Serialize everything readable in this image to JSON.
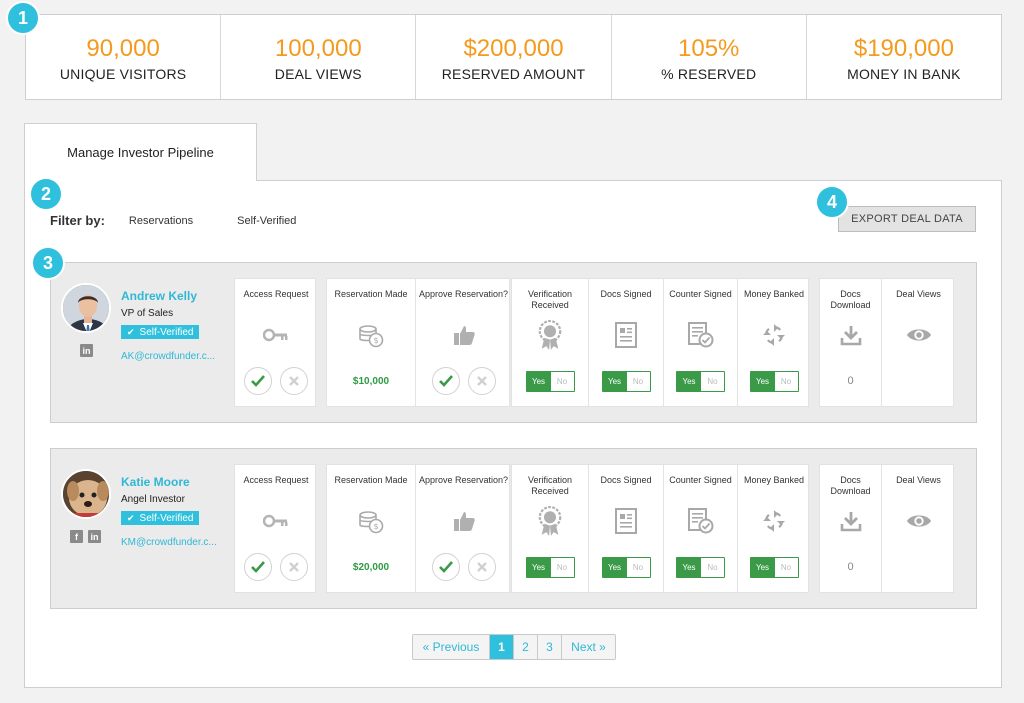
{
  "stats": [
    {
      "value": "90,000",
      "label": "UNIQUE VISITORS"
    },
    {
      "value": "100,000",
      "label": "DEAL VIEWS"
    },
    {
      "value": "$200,000",
      "label": "RESERVED AMOUNT"
    },
    {
      "value": "105%",
      "label": "% RESERVED"
    },
    {
      "value": "$190,000",
      "label": "MONEY IN BANK"
    }
  ],
  "badges": [
    "1",
    "2",
    "3",
    "4"
  ],
  "tab": {
    "label": "Manage Investor Pipeline"
  },
  "filter": {
    "label": "Filter by:",
    "options": [
      "Reservations",
      "Self-Verified"
    ]
  },
  "export_label": "EXPORT DEAL DATA",
  "columns": {
    "access": "Access Request",
    "reservation": "Reservation Made",
    "approve": "Approve Reservation?",
    "verification": "Verification Received",
    "docs_signed": "Docs Signed",
    "counter": "Counter Signed",
    "banked": "Money Banked",
    "download": "Docs Download",
    "views": "Deal Views"
  },
  "toggle": {
    "yes": "Yes",
    "no": "No"
  },
  "investors": [
    {
      "name": "Andrew Kelly",
      "title": "VP of Sales",
      "badge": "Self-Verified",
      "email": "AK@crowdfunder.c...",
      "amount": "$10,000",
      "downloads": "0"
    },
    {
      "name": "Katie Moore",
      "title": "Angel Investor",
      "badge": "Self-Verified",
      "email": "KM@crowdfunder.c...",
      "amount": "$20,000",
      "downloads": "0"
    }
  ],
  "pagination": {
    "prev": "« Previous",
    "pages": [
      "1",
      "2",
      "3"
    ],
    "current": "1",
    "next": "Next »"
  },
  "colors": {
    "accent": "#2fc0dd",
    "stat_value": "#f39a1f",
    "green": "#3a9a47"
  }
}
